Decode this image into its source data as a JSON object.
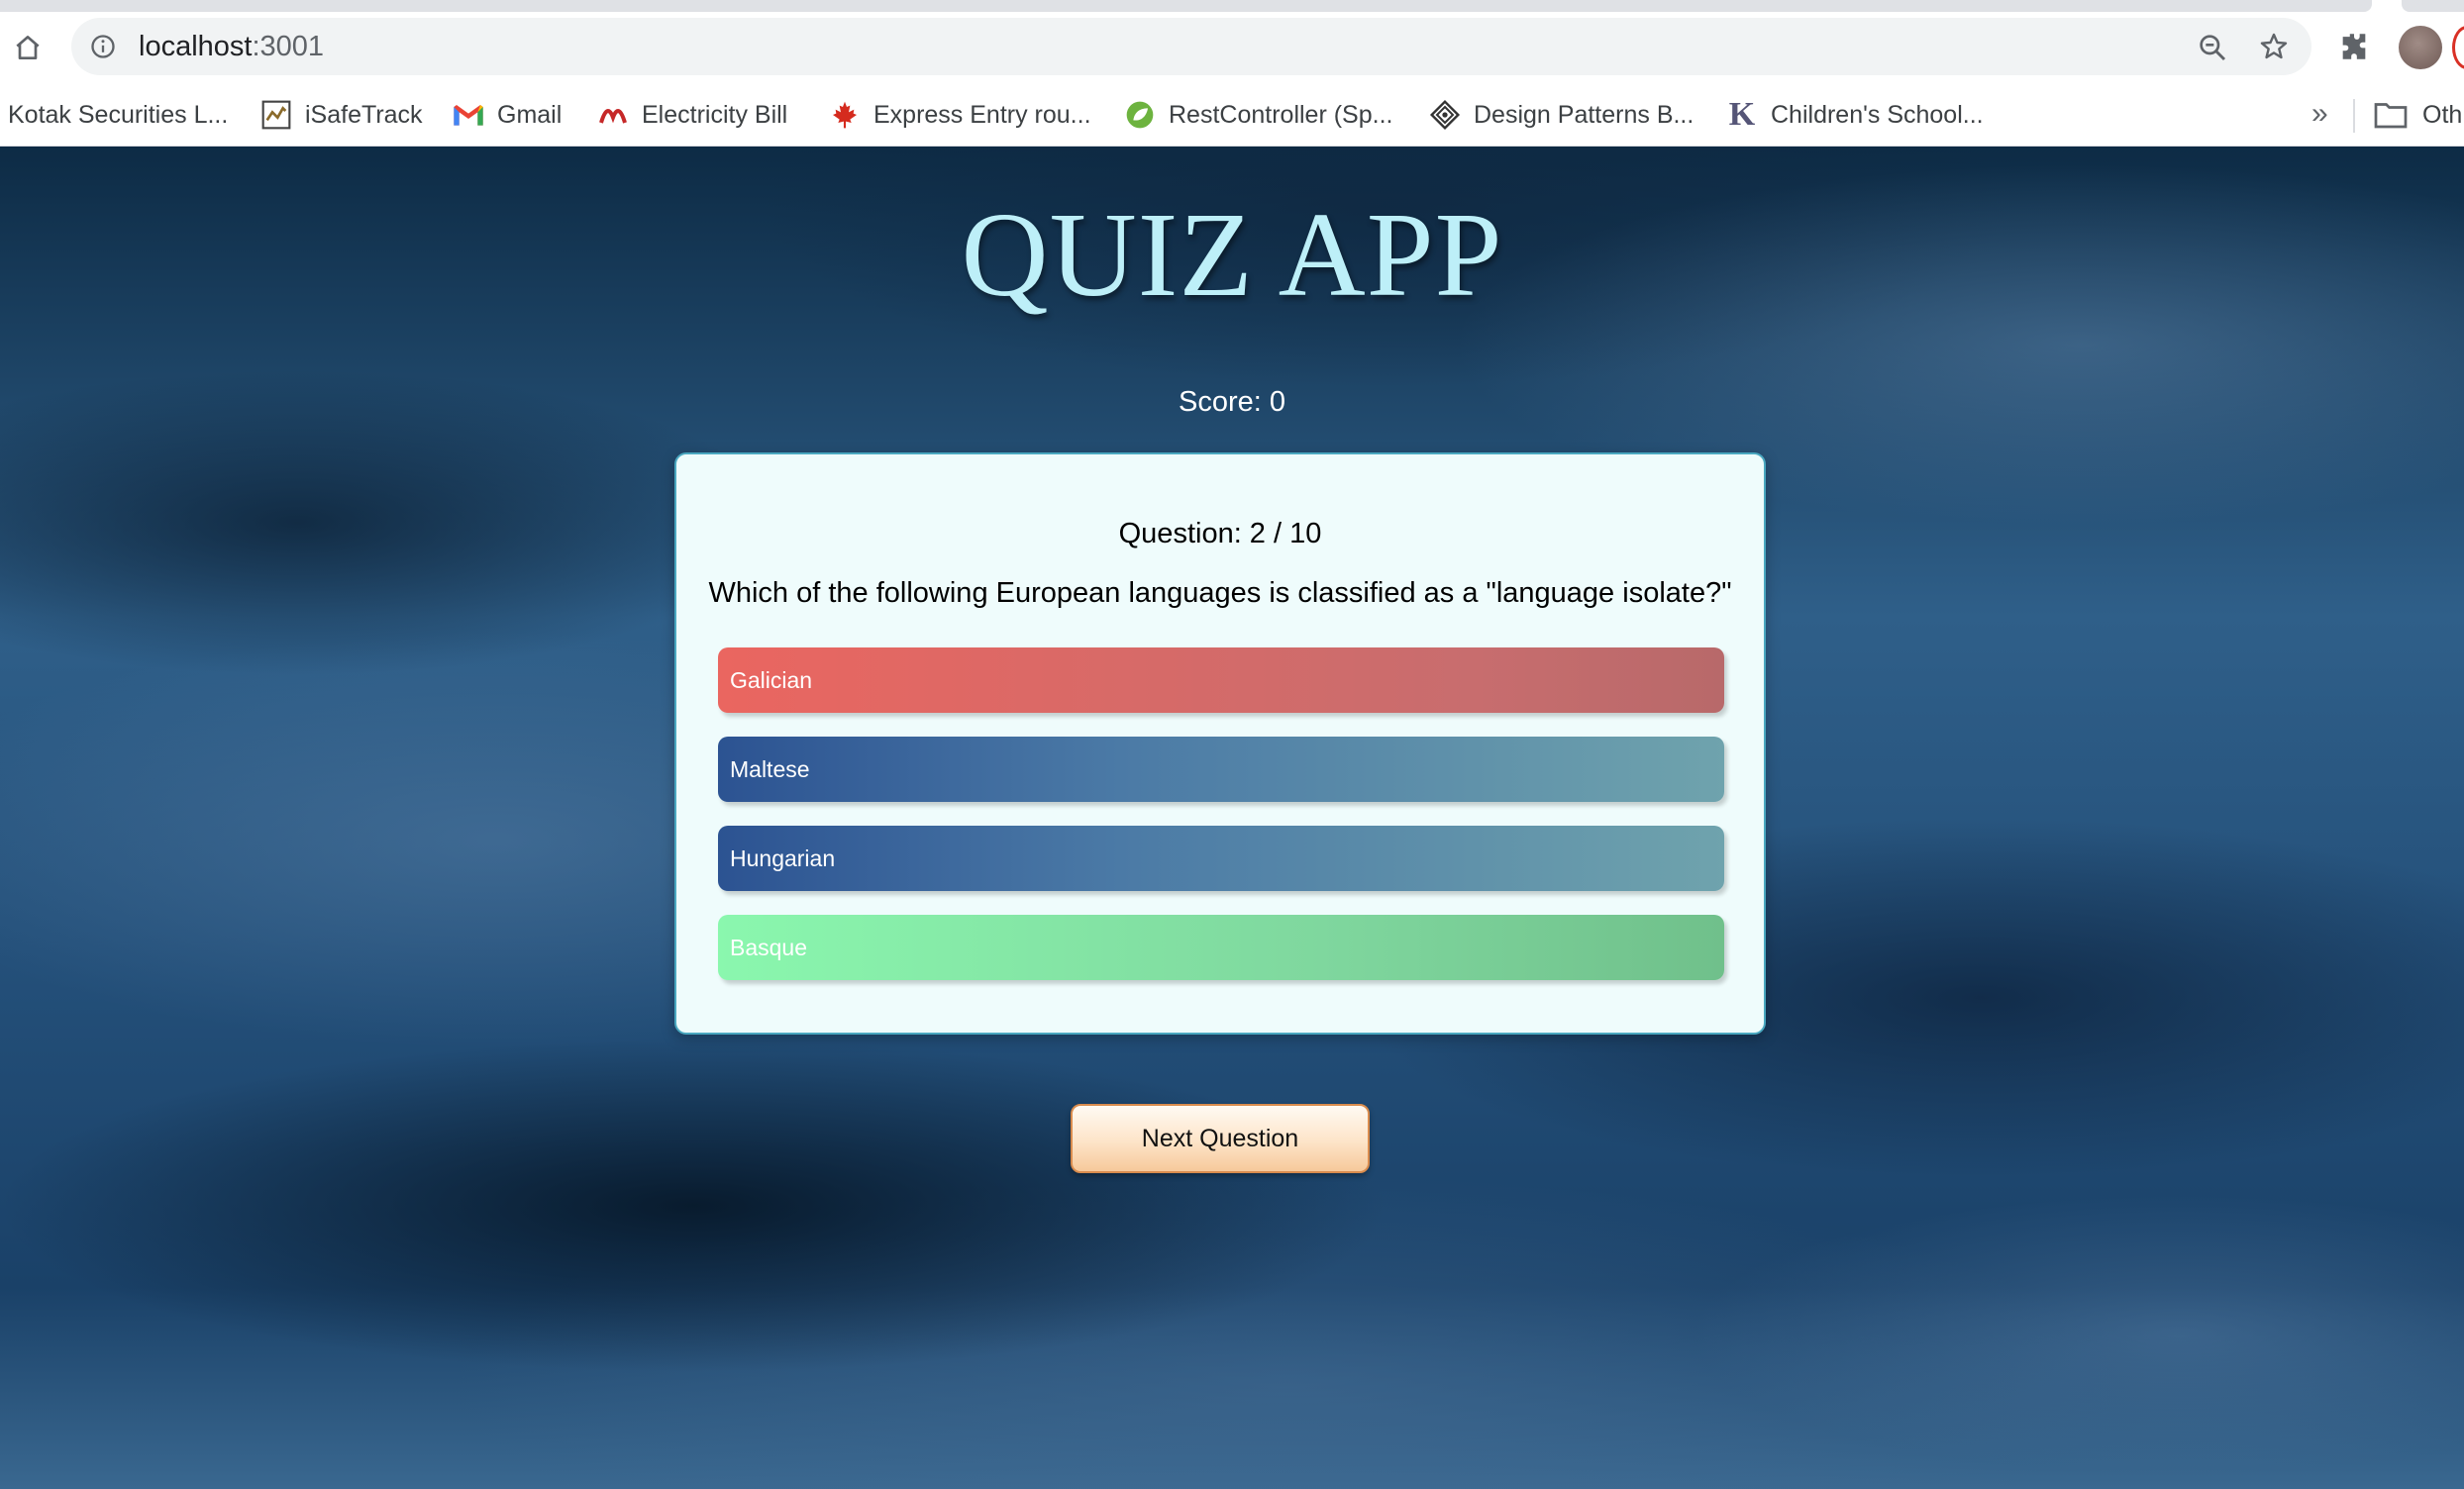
{
  "browser": {
    "url_host": "localhost",
    "url_port": ":3001",
    "bookmarks": [
      {
        "label": "Kotak Securities L...",
        "icon": "kotak-icon"
      },
      {
        "label": "iSafeTrack",
        "icon": "isafetrack-icon"
      },
      {
        "label": "Gmail",
        "icon": "gmail-icon"
      },
      {
        "label": "Electricity Bill",
        "icon": "electricity-icon"
      },
      {
        "label": "Express Entry rou...",
        "icon": "maple-leaf-icon"
      },
      {
        "label": "RestController (Sp...",
        "icon": "spring-icon"
      },
      {
        "label": "Design Patterns B...",
        "icon": "design-patterns-icon"
      },
      {
        "label": "Children's School...",
        "icon": "k-letter-icon"
      }
    ],
    "more_label": "»",
    "other_label": "Oth"
  },
  "app": {
    "title": "QUIZ APP",
    "score_text": "Score: 0",
    "question_number": "Question: 2 / 10",
    "question_text": "Which of the following European languages is classified as a \"language isolate?\"",
    "answers": [
      "Galician",
      "Maltese",
      "Hungarian",
      "Basque"
    ],
    "next_label": "Next Question"
  },
  "colors": {
    "wrong_answer": "#ea6660",
    "neutral_answer": "#2c5392",
    "correct_answer": "#8af7ae",
    "title": "#bdeff8",
    "card_bg": "#effcfc",
    "next_button": "#fde4c8"
  }
}
